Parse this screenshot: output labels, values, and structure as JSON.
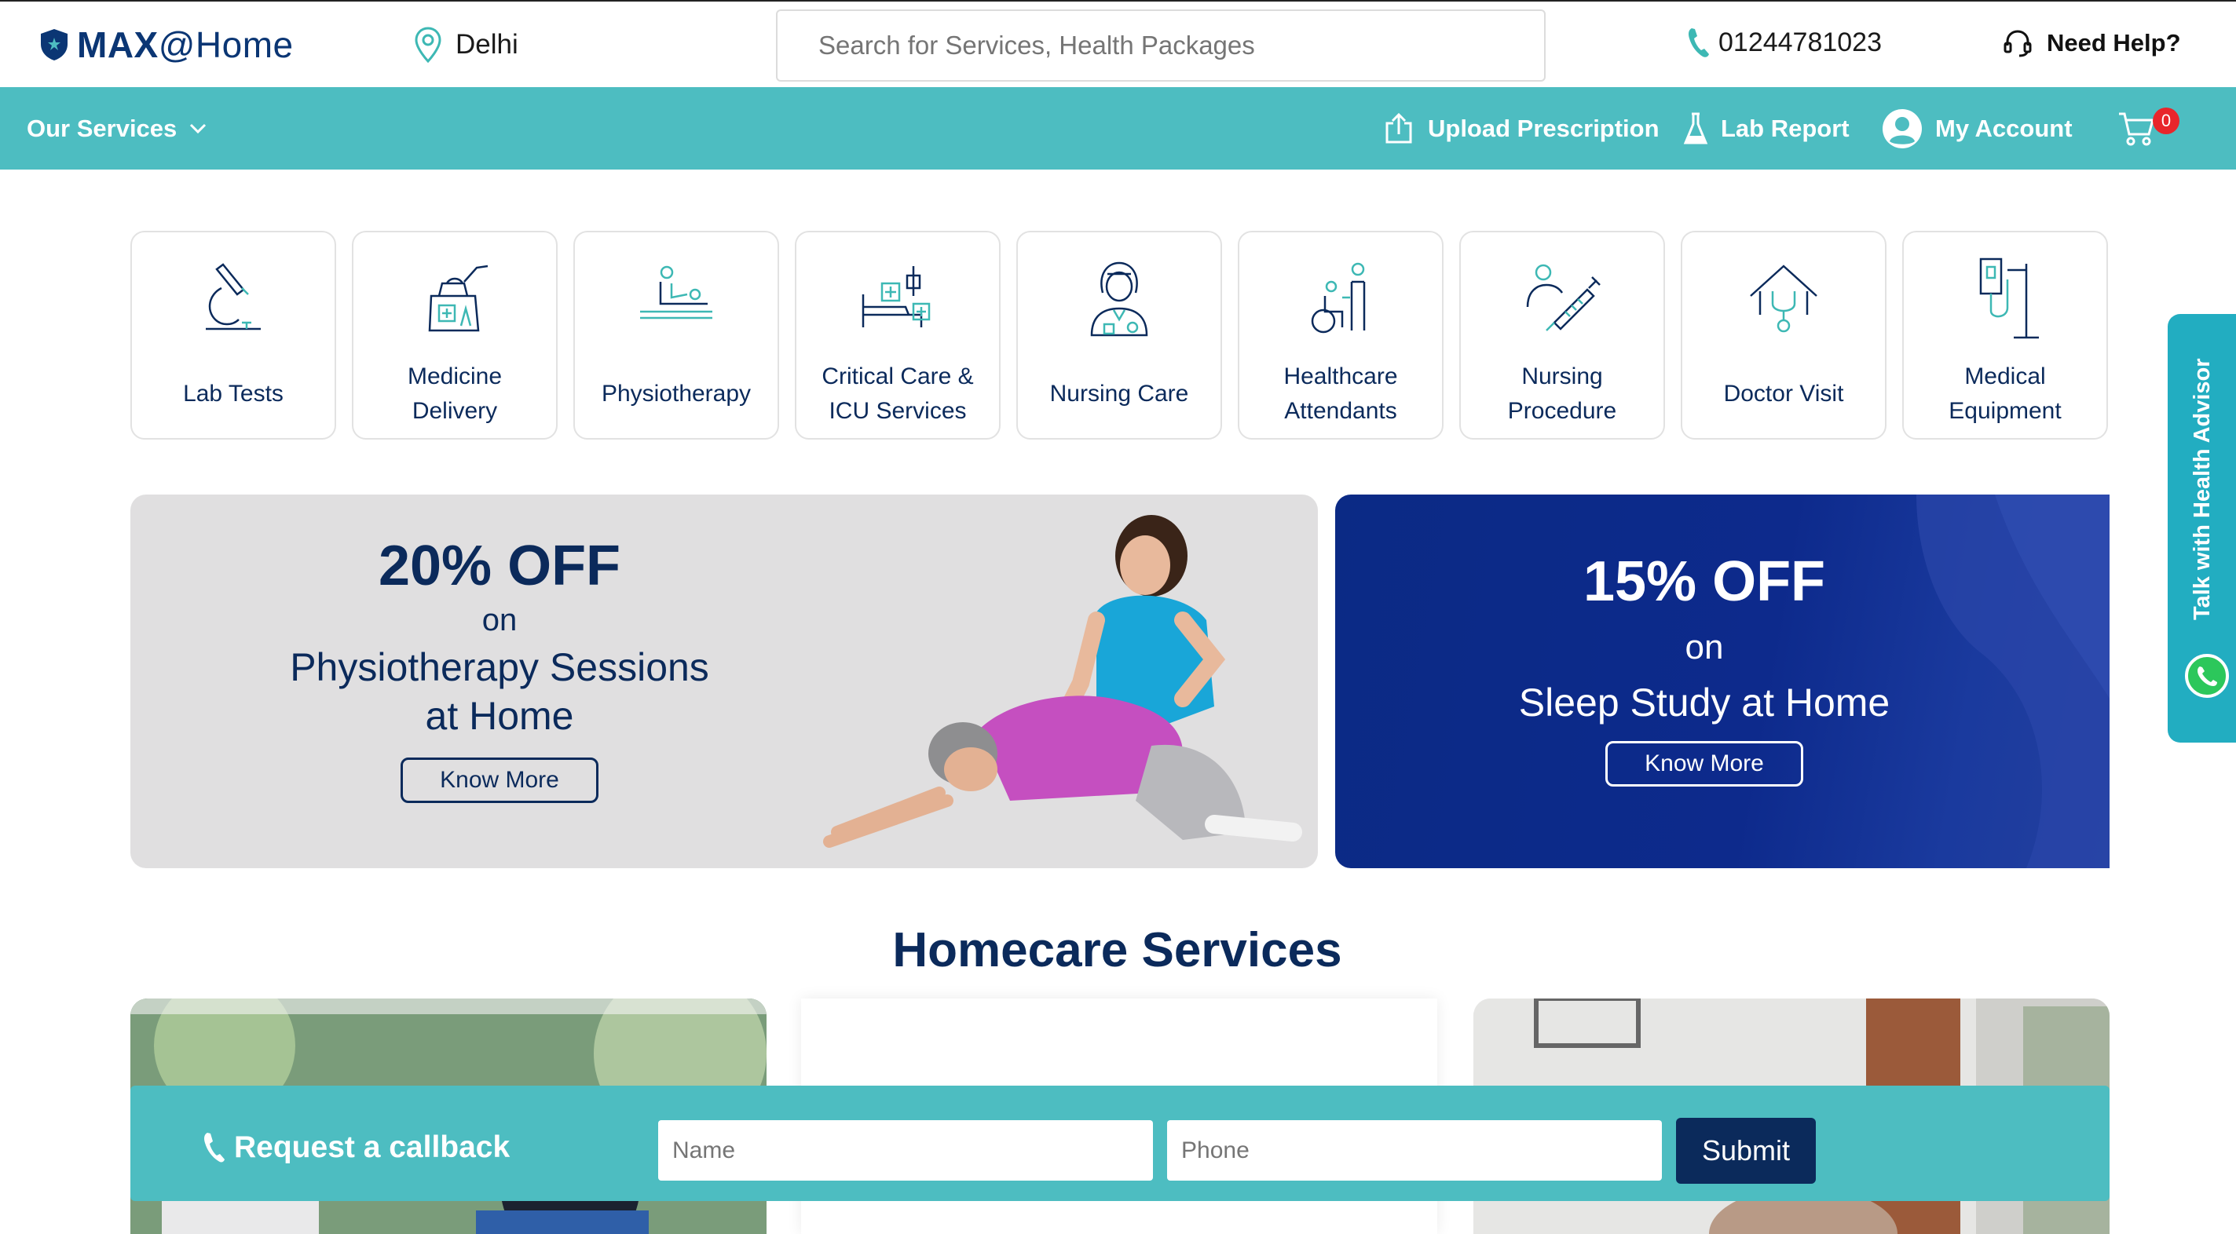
{
  "header": {
    "logo_brand": "MAX",
    "logo_suffix": "@Home",
    "location": "Delhi",
    "search_placeholder": "Search for Services, Health Packages",
    "phone": "01244781023",
    "help_label": "Need Help?"
  },
  "navbar": {
    "services_label": "Our Services",
    "upload_label": "Upload Prescription",
    "lab_report_label": "Lab Report",
    "account_label": "My Account",
    "cart_count": "0"
  },
  "services": [
    {
      "label": "Lab Tests",
      "icon": "microscope-icon"
    },
    {
      "label": "Medicine Delivery",
      "icon": "medicine-bag-icon"
    },
    {
      "label": "Physiotherapy",
      "icon": "physiotherapy-icon"
    },
    {
      "label": "Critical Care & ICU Services",
      "icon": "icu-bed-icon"
    },
    {
      "label": "Nursing Care",
      "icon": "nurse-icon"
    },
    {
      "label": "Healthcare Attendants",
      "icon": "wheelchair-attendant-icon"
    },
    {
      "label": "Nursing Procedure",
      "icon": "syringe-icon"
    },
    {
      "label": "Doctor Visit",
      "icon": "home-stethoscope-icon"
    },
    {
      "label": "Medical Equipment",
      "icon": "iv-stand-icon"
    }
  ],
  "banner_physio": {
    "discount": "20% OFF",
    "on": "on",
    "line1": "Physiotherapy Sessions",
    "line2": "at Home",
    "cta": "Know More"
  },
  "banner_sleep": {
    "discount": "15% OFF",
    "on": "on",
    "line1": "Sleep Study at Home",
    "cta": "Know More"
  },
  "section_title": "Homecare Services",
  "callback": {
    "title": "Request a callback",
    "name_placeholder": "Name",
    "phone_placeholder": "Phone",
    "submit": "Submit"
  },
  "advisor_label": "Talk with Health Advisor",
  "colors": {
    "teal": "#4dbdc1",
    "navy": "#0b2a5b",
    "banner_blue": "#0d2a8c",
    "advisor": "#22adc1"
  }
}
